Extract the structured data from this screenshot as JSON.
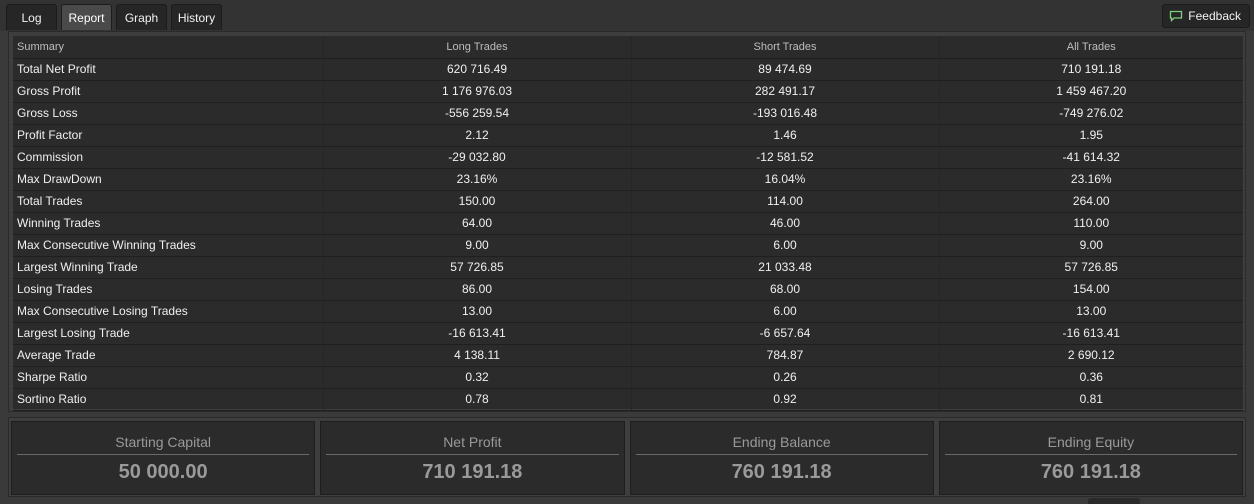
{
  "tabs": [
    {
      "label": "Log",
      "active": false
    },
    {
      "label": "Report",
      "active": true
    },
    {
      "label": "Graph",
      "active": false
    },
    {
      "label": "History",
      "active": false
    }
  ],
  "feedback": {
    "label": "Feedback",
    "icon": "speech-bubble-icon"
  },
  "report": {
    "columns": [
      "Summary",
      "Long Trades",
      "Short Trades",
      "All Trades"
    ],
    "rows": [
      {
        "label": "Total Net Profit",
        "long": "620 716.49",
        "short": "89 474.69",
        "all": "710 191.18"
      },
      {
        "label": "Gross Profit",
        "long": "1 176 976.03",
        "short": "282 491.17",
        "all": "1 459 467.20"
      },
      {
        "label": "Gross Loss",
        "long": "-556 259.54",
        "short": "-193 016.48",
        "all": "-749 276.02"
      },
      {
        "label": "Profit Factor",
        "long": "2.12",
        "short": "1.46",
        "all": "1.95"
      },
      {
        "label": "Commission",
        "long": "-29 032.80",
        "short": "-12 581.52",
        "all": "-41 614.32"
      },
      {
        "label": "Max DrawDown",
        "long": "23.16%",
        "short": "16.04%",
        "all": "23.16%"
      },
      {
        "label": "Total Trades",
        "long": "150.00",
        "short": "114.00",
        "all": "264.00"
      },
      {
        "label": "Winning Trades",
        "long": "64.00",
        "short": "46.00",
        "all": "110.00"
      },
      {
        "label": "Max Consecutive Winning Trades",
        "long": "9.00",
        "short": "6.00",
        "all": "9.00"
      },
      {
        "label": "Largest Winning Trade",
        "long": "57 726.85",
        "short": "21 033.48",
        "all": "57 726.85"
      },
      {
        "label": "Losing Trades",
        "long": "86.00",
        "short": "68.00",
        "all": "154.00"
      },
      {
        "label": "Max Consecutive Losing Trades",
        "long": "13.00",
        "short": "6.00",
        "all": "13.00"
      },
      {
        "label": "Largest Losing Trade",
        "long": "-16 613.41",
        "short": "-6 657.64",
        "all": "-16 613.41"
      },
      {
        "label": "Average Trade",
        "long": "4 138.11",
        "short": "784.87",
        "all": "2 690.12"
      },
      {
        "label": "Sharpe Ratio",
        "long": "0.32",
        "short": "0.26",
        "all": "0.36"
      },
      {
        "label": "Sortino Ratio",
        "long": "0.78",
        "short": "0.92",
        "all": "0.81"
      }
    ]
  },
  "cards": [
    {
      "label": "Starting Capital",
      "value": "50 000.00"
    },
    {
      "label": "Net Profit",
      "value": "710 191.18"
    },
    {
      "label": "Ending Balance",
      "value": "760 191.18"
    },
    {
      "label": "Ending Equity",
      "value": "760 191.18"
    }
  ],
  "colors": {
    "background": "#3a3a3a",
    "panel": "#2b2b2b",
    "text": "#f0f0f0",
    "muted": "#9a9a9a"
  }
}
